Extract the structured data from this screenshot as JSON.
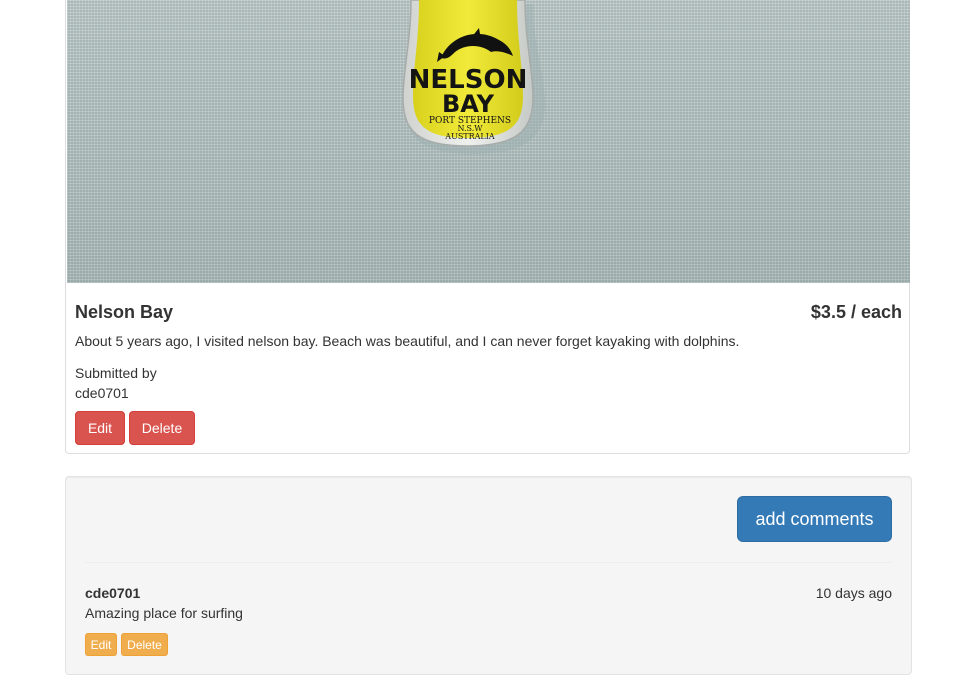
{
  "place": {
    "photo_subject": "Nelson Bay souvenir keychain on textured fabric",
    "souvenir_text": {
      "line1": "NELSON",
      "line2": "BAY",
      "line3": "PORT STEPHENS",
      "line4": "N.S.W",
      "line5": "AUSTRALIA"
    },
    "title": "Nelson Bay",
    "price": "$3.5 / each",
    "description": "About 5 years ago, I visited nelson bay. Beach was beautiful, and I can never forget kayaking with dolphins.",
    "submitted_label": "Submitted by",
    "author": "cde0701",
    "edit_label": "Edit",
    "delete_label": "Delete"
  },
  "comments_panel": {
    "add_label": "add comments",
    "comments": [
      {
        "author": "cde0701",
        "time": "10 days ago",
        "text": "Amazing place for surfing",
        "edit_label": "Edit",
        "delete_label": "Delete"
      }
    ]
  },
  "colors": {
    "danger": "#d9534f",
    "primary": "#337ab7",
    "warning": "#f0ad4e",
    "souvenir_yellow": "#e8e12a"
  }
}
